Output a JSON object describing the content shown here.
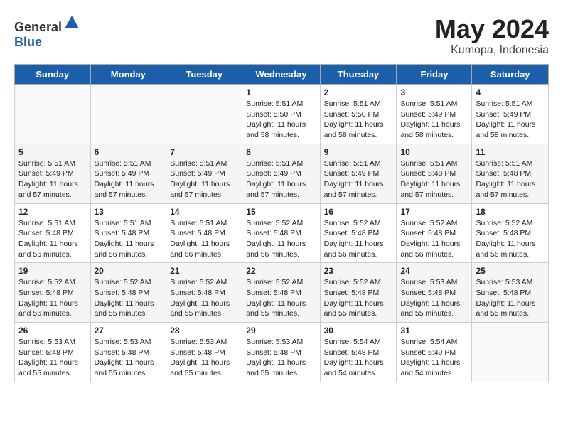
{
  "header": {
    "logo_general": "General",
    "logo_blue": "Blue",
    "month": "May 2024",
    "location": "Kumopa, Indonesia"
  },
  "weekdays": [
    "Sunday",
    "Monday",
    "Tuesday",
    "Wednesday",
    "Thursday",
    "Friday",
    "Saturday"
  ],
  "weeks": [
    [
      {
        "day": "",
        "info": ""
      },
      {
        "day": "",
        "info": ""
      },
      {
        "day": "",
        "info": ""
      },
      {
        "day": "1",
        "info": "Sunrise: 5:51 AM\nSunset: 5:50 PM\nDaylight: 11 hours\nand 58 minutes."
      },
      {
        "day": "2",
        "info": "Sunrise: 5:51 AM\nSunset: 5:50 PM\nDaylight: 11 hours\nand 58 minutes."
      },
      {
        "day": "3",
        "info": "Sunrise: 5:51 AM\nSunset: 5:49 PM\nDaylight: 11 hours\nand 58 minutes."
      },
      {
        "day": "4",
        "info": "Sunrise: 5:51 AM\nSunset: 5:49 PM\nDaylight: 11 hours\nand 58 minutes."
      }
    ],
    [
      {
        "day": "5",
        "info": "Sunrise: 5:51 AM\nSunset: 5:49 PM\nDaylight: 11 hours\nand 57 minutes."
      },
      {
        "day": "6",
        "info": "Sunrise: 5:51 AM\nSunset: 5:49 PM\nDaylight: 11 hours\nand 57 minutes."
      },
      {
        "day": "7",
        "info": "Sunrise: 5:51 AM\nSunset: 5:49 PM\nDaylight: 11 hours\nand 57 minutes."
      },
      {
        "day": "8",
        "info": "Sunrise: 5:51 AM\nSunset: 5:49 PM\nDaylight: 11 hours\nand 57 minutes."
      },
      {
        "day": "9",
        "info": "Sunrise: 5:51 AM\nSunset: 5:49 PM\nDaylight: 11 hours\nand 57 minutes."
      },
      {
        "day": "10",
        "info": "Sunrise: 5:51 AM\nSunset: 5:48 PM\nDaylight: 11 hours\nand 57 minutes."
      },
      {
        "day": "11",
        "info": "Sunrise: 5:51 AM\nSunset: 5:48 PM\nDaylight: 11 hours\nand 57 minutes."
      }
    ],
    [
      {
        "day": "12",
        "info": "Sunrise: 5:51 AM\nSunset: 5:48 PM\nDaylight: 11 hours\nand 56 minutes."
      },
      {
        "day": "13",
        "info": "Sunrise: 5:51 AM\nSunset: 5:48 PM\nDaylight: 11 hours\nand 56 minutes."
      },
      {
        "day": "14",
        "info": "Sunrise: 5:51 AM\nSunset: 5:48 PM\nDaylight: 11 hours\nand 56 minutes."
      },
      {
        "day": "15",
        "info": "Sunrise: 5:52 AM\nSunset: 5:48 PM\nDaylight: 11 hours\nand 56 minutes."
      },
      {
        "day": "16",
        "info": "Sunrise: 5:52 AM\nSunset: 5:48 PM\nDaylight: 11 hours\nand 56 minutes."
      },
      {
        "day": "17",
        "info": "Sunrise: 5:52 AM\nSunset: 5:48 PM\nDaylight: 11 hours\nand 56 minutes."
      },
      {
        "day": "18",
        "info": "Sunrise: 5:52 AM\nSunset: 5:48 PM\nDaylight: 11 hours\nand 56 minutes."
      }
    ],
    [
      {
        "day": "19",
        "info": "Sunrise: 5:52 AM\nSunset: 5:48 PM\nDaylight: 11 hours\nand 56 minutes."
      },
      {
        "day": "20",
        "info": "Sunrise: 5:52 AM\nSunset: 5:48 PM\nDaylight: 11 hours\nand 55 minutes."
      },
      {
        "day": "21",
        "info": "Sunrise: 5:52 AM\nSunset: 5:48 PM\nDaylight: 11 hours\nand 55 minutes."
      },
      {
        "day": "22",
        "info": "Sunrise: 5:52 AM\nSunset: 5:48 PM\nDaylight: 11 hours\nand 55 minutes."
      },
      {
        "day": "23",
        "info": "Sunrise: 5:52 AM\nSunset: 5:48 PM\nDaylight: 11 hours\nand 55 minutes."
      },
      {
        "day": "24",
        "info": "Sunrise: 5:53 AM\nSunset: 5:48 PM\nDaylight: 11 hours\nand 55 minutes."
      },
      {
        "day": "25",
        "info": "Sunrise: 5:53 AM\nSunset: 5:48 PM\nDaylight: 11 hours\nand 55 minutes."
      }
    ],
    [
      {
        "day": "26",
        "info": "Sunrise: 5:53 AM\nSunset: 5:48 PM\nDaylight: 11 hours\nand 55 minutes."
      },
      {
        "day": "27",
        "info": "Sunrise: 5:53 AM\nSunset: 5:48 PM\nDaylight: 11 hours\nand 55 minutes."
      },
      {
        "day": "28",
        "info": "Sunrise: 5:53 AM\nSunset: 5:48 PM\nDaylight: 11 hours\nand 55 minutes."
      },
      {
        "day": "29",
        "info": "Sunrise: 5:53 AM\nSunset: 5:48 PM\nDaylight: 11 hours\nand 55 minutes."
      },
      {
        "day": "30",
        "info": "Sunrise: 5:54 AM\nSunset: 5:48 PM\nDaylight: 11 hours\nand 54 minutes."
      },
      {
        "day": "31",
        "info": "Sunrise: 5:54 AM\nSunset: 5:49 PM\nDaylight: 11 hours\nand 54 minutes."
      },
      {
        "day": "",
        "info": ""
      }
    ]
  ]
}
